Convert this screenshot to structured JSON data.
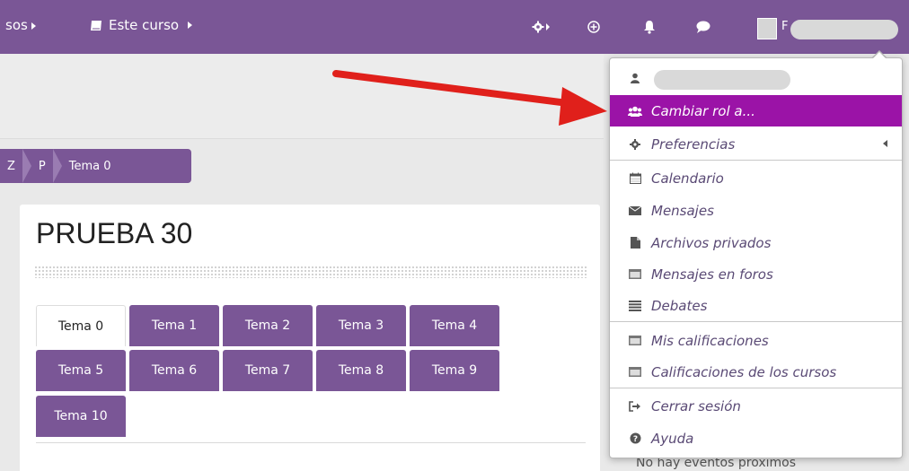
{
  "navbar": {
    "cursos_partial": "sos",
    "este_curso": "Este curso",
    "user_initial": "F"
  },
  "breadcrumb": {
    "items": [
      "Z",
      "P",
      "Tema 0"
    ]
  },
  "course": {
    "title": "PRUEBA 30",
    "tabs": [
      "Tema 0",
      "Tema 1",
      "Tema 2",
      "Tema 3",
      "Tema 4",
      "Tema 5",
      "Tema 6",
      "Tema 7",
      "Tema 8",
      "Tema 9",
      "Tema 10"
    ],
    "active_tab": "Tema 0"
  },
  "user_menu": {
    "items": [
      {
        "label": "Cambiar rol a...",
        "icon": "users-icon"
      },
      {
        "label": "Preferencias",
        "icon": "gear-icon"
      },
      {
        "label": "Calendario",
        "icon": "calendar-icon"
      },
      {
        "label": "Mensajes",
        "icon": "envelope-icon"
      },
      {
        "label": "Archivos privados",
        "icon": "file-icon"
      },
      {
        "label": "Mensajes en foros",
        "icon": "table-icon"
      },
      {
        "label": "Debates",
        "icon": "list-icon"
      },
      {
        "label": "Mis calificaciones",
        "icon": "table-icon"
      },
      {
        "label": "Calificaciones de los cursos",
        "icon": "table-icon"
      },
      {
        "label": "Cerrar sesión",
        "icon": "sign-out-icon"
      },
      {
        "label": "Ayuda",
        "icon": "question-icon"
      }
    ]
  },
  "calendar_block": {
    "text": "No hay eventos próximos"
  },
  "colors": {
    "brand": "#7a5696",
    "active_item": "#9b13a7",
    "annotation_arrow": "#e0201b"
  }
}
